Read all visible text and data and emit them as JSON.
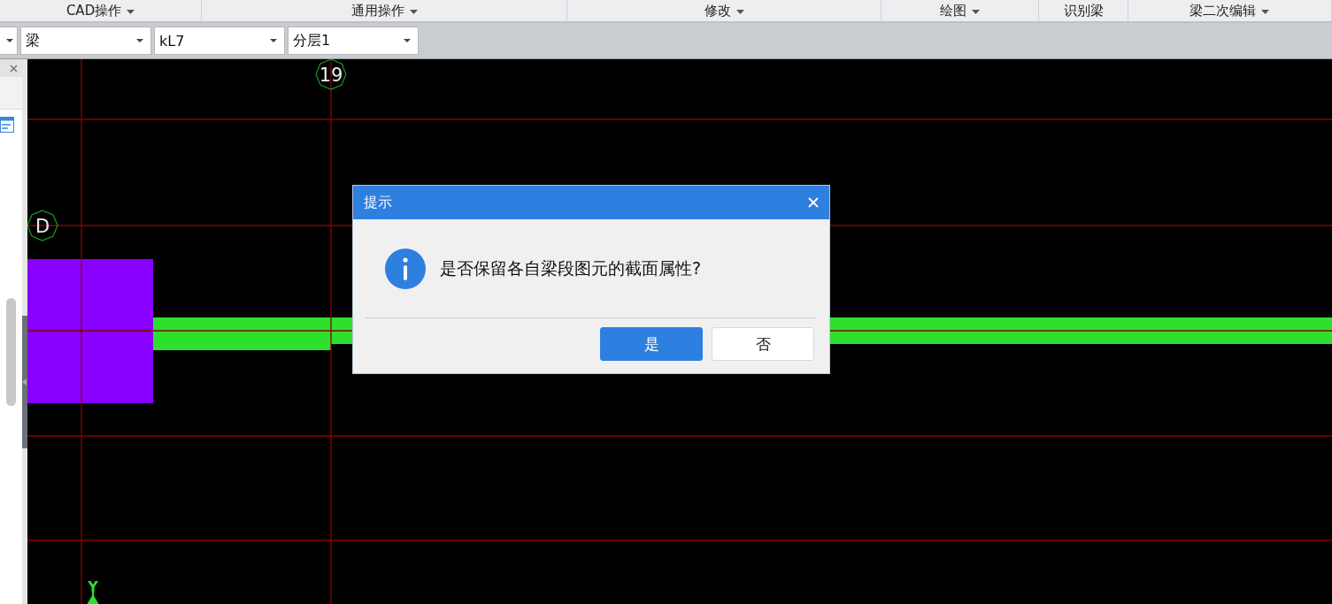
{
  "ribbon_groups": [
    {
      "label": "CAD操作",
      "dropdown": true
    },
    {
      "label": "通用操作",
      "dropdown": true
    },
    {
      "label": "修改",
      "dropdown": true
    },
    {
      "label": "绘图",
      "dropdown": true
    },
    {
      "label": "识别梁",
      "dropdown": false
    },
    {
      "label": "梁二次编辑",
      "dropdown": true
    }
  ],
  "selectors": [
    {
      "value": "梁"
    },
    {
      "value": "kL7"
    },
    {
      "value": "分层1"
    }
  ],
  "canvas": {
    "axis_labels": [
      {
        "text": "19"
      },
      {
        "text": "D"
      }
    ],
    "y_axis_label": "Y"
  },
  "dialog": {
    "title": "提示",
    "message": "是否保留各自梁段图元的截面属性?",
    "buttons": [
      {
        "label": "是",
        "default": true
      },
      {
        "label": "否",
        "default": false
      }
    ]
  }
}
